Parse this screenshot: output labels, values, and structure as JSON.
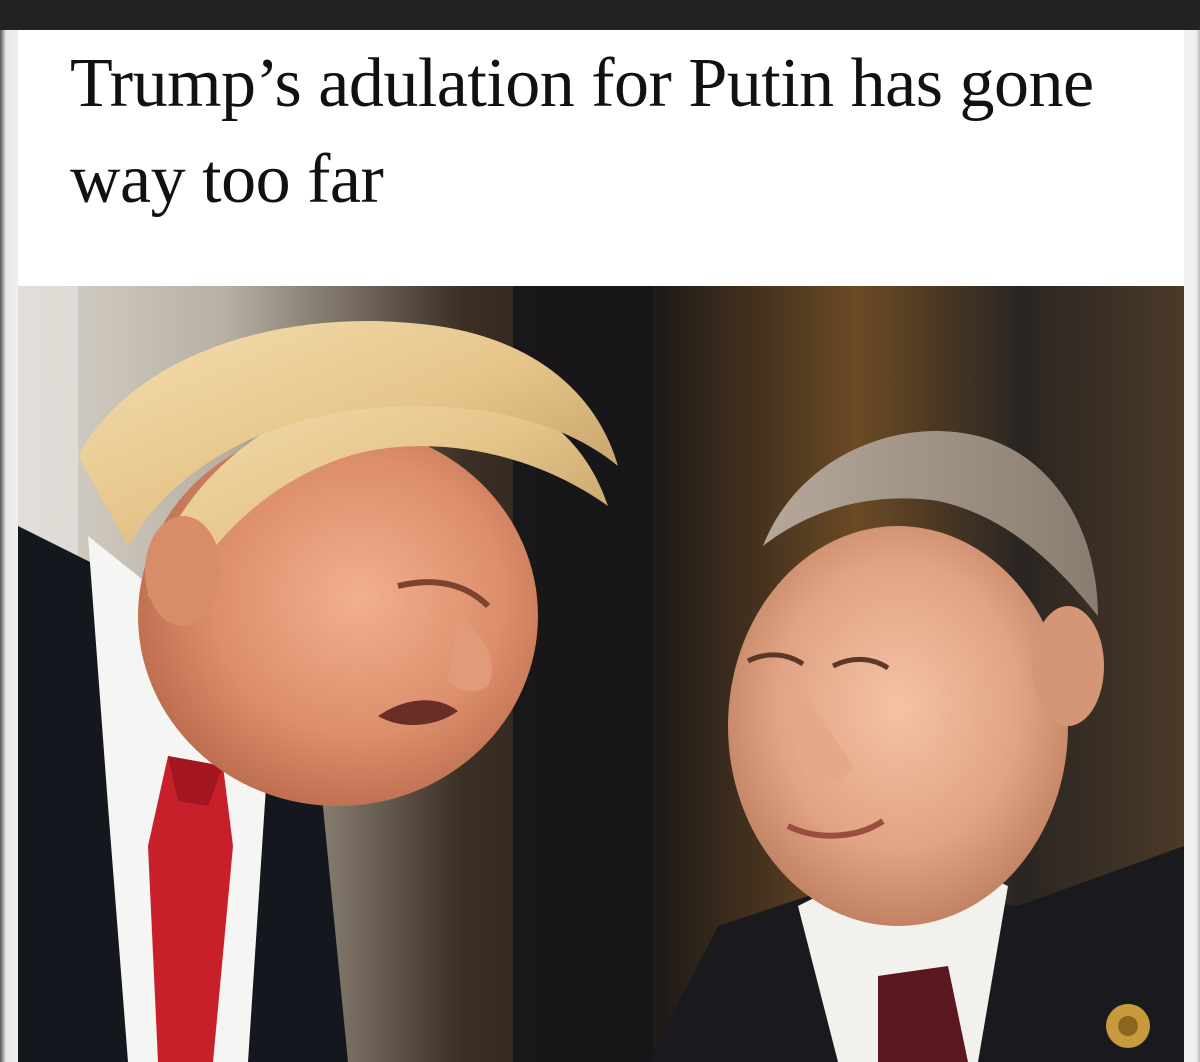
{
  "article": {
    "headline": "Trump’s adulation for Putin has gone way too far"
  },
  "photo": {
    "subject_icon": "photo-of-two-men"
  },
  "colors": {
    "headline_text": "#111111",
    "panel_background": "#ffffff",
    "tie_left": "#c8202a",
    "tie_right": "#5a1820"
  }
}
